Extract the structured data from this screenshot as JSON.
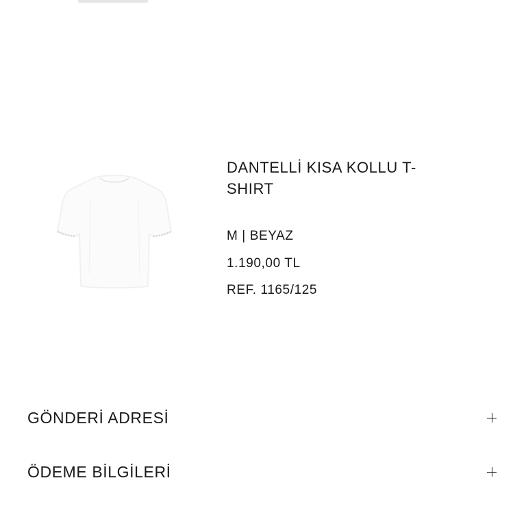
{
  "product": {
    "name": "DANTELLİ KISA KOLLU T-SHIRT",
    "size_color": "M | BEYAZ",
    "price": "1.190,00 TL",
    "ref": "REF. 1165/125",
    "image_icon": "white-lace-tshirt-image"
  },
  "accordions": [
    {
      "title": "GÖNDERİ ADRESİ",
      "icon": "plus-icon"
    },
    {
      "title": "ÖDEME BİLGİLERİ",
      "icon": "plus-icon"
    }
  ]
}
